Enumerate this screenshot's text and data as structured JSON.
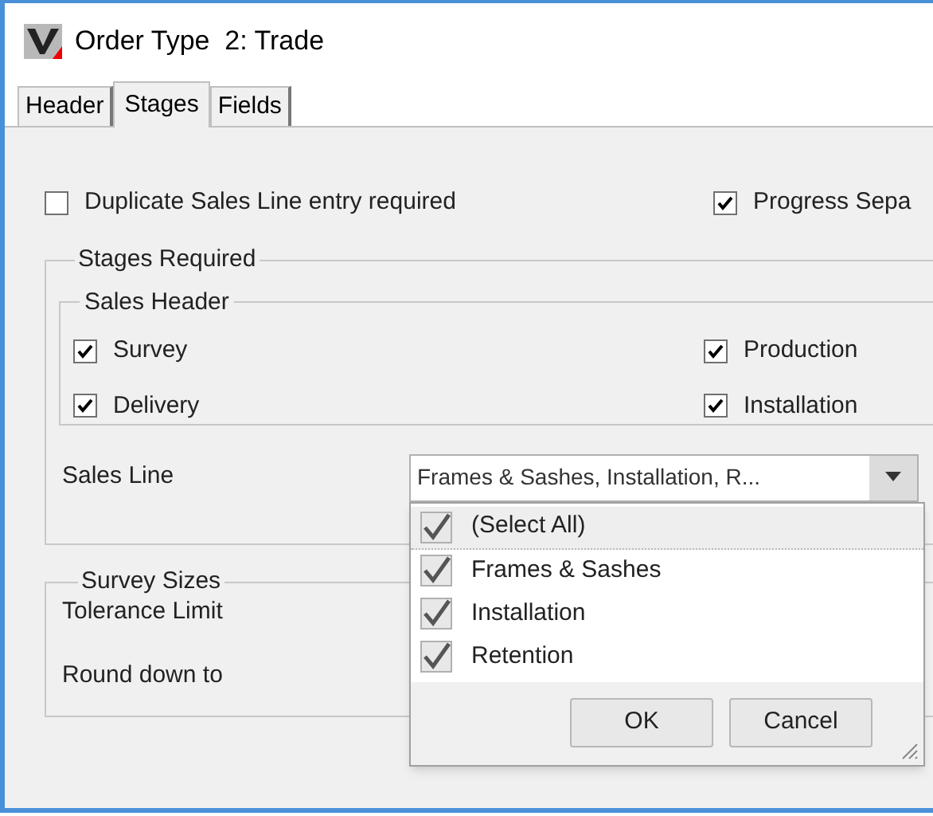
{
  "window": {
    "title": "Order Type  2: Trade"
  },
  "tabs": [
    {
      "label": "Header",
      "selected": false
    },
    {
      "label": "Stages",
      "selected": true
    },
    {
      "label": "Fields",
      "selected": false
    }
  ],
  "options": [
    {
      "label": "Duplicate Sales Line entry required",
      "checked": false
    },
    {
      "label": "Progress Sepa",
      "checked": true
    }
  ],
  "stages_required": {
    "title": "Stages Required",
    "sales_header": {
      "title": "Sales Header",
      "items": [
        {
          "label": "Survey",
          "checked": true
        },
        {
          "label": "Production",
          "checked": true
        },
        {
          "label": "Delivery",
          "checked": true
        },
        {
          "label": "Installation",
          "checked": true
        }
      ]
    },
    "sales_line": {
      "label": "Sales Line",
      "value": "Frames & Sashes, Installation, R...",
      "expanded": true,
      "dropdown": {
        "items": [
          {
            "label": "(Select All)",
            "checked": true
          },
          {
            "label": "Frames & Sashes",
            "checked": true
          },
          {
            "label": "Installation",
            "checked": true
          },
          {
            "label": "Retention",
            "checked": true
          }
        ],
        "buttons": [
          "OK",
          "Cancel"
        ]
      }
    }
  },
  "survey_sizes": {
    "title": "Survey Sizes",
    "fields": [
      "Tolerance Limit",
      "Round down to"
    ]
  }
}
